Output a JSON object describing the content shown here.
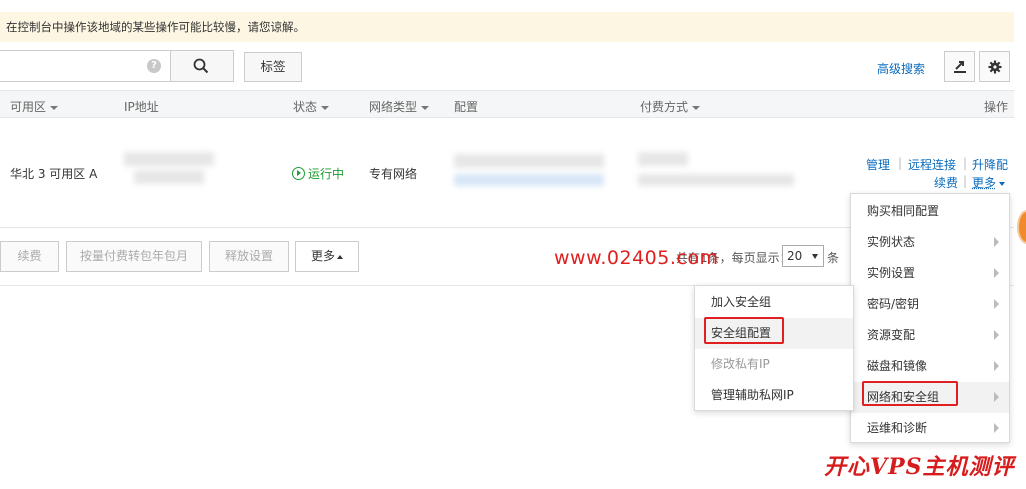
{
  "notice": {
    "text": "在控制台中操作该地域的某些操作可能比较慢，请您谅解。"
  },
  "toolbar": {
    "search_placeholder": "",
    "help_glyph": "?",
    "tag_label": "标签",
    "advanced_search": "高级搜索"
  },
  "table": {
    "headers": {
      "zone": "可用区",
      "ip": "IP地址",
      "status": "状态",
      "network": "网络类型",
      "config": "配置",
      "billing": "付费方式",
      "actions": "操作"
    },
    "row": {
      "zone": "华北 3 可用区 A",
      "status": "运行中",
      "network": "专有网络",
      "actions": {
        "manage": "管理",
        "remote": "远程连接",
        "upgrade": "升降配",
        "renew": "续费",
        "more": "更多"
      }
    }
  },
  "bulk_actions": {
    "renew": "续费",
    "convert": "按量付费转包年包月",
    "release": "释放设置",
    "more": "更多"
  },
  "pager": {
    "total_prefix": "共有1条，每页显示：",
    "page_size": "20",
    "unit": "条"
  },
  "watermark": "www.02405.com",
  "more_menu": {
    "items": [
      {
        "label": "购买相同配置",
        "submenu": false
      },
      {
        "label": "实例状态",
        "submenu": true
      },
      {
        "label": "实例设置",
        "submenu": true
      },
      {
        "label": "密码/密钥",
        "submenu": true
      },
      {
        "label": "资源变配",
        "submenu": true
      },
      {
        "label": "磁盘和镜像",
        "submenu": true
      },
      {
        "label": "网络和安全组",
        "submenu": true
      },
      {
        "label": "运维和诊断",
        "submenu": true
      }
    ]
  },
  "sub_menu": {
    "items": [
      {
        "label": "加入安全组",
        "disabled": false
      },
      {
        "label": "安全组配置",
        "disabled": false
      },
      {
        "label": "修改私有IP",
        "disabled": true
      },
      {
        "label": "管理辅助私网IP",
        "disabled": false
      }
    ]
  },
  "brand": "开心VPS主机测评",
  "colors": {
    "link": "#0a6bbd",
    "running": "#1e9b34",
    "highlight": "#e02020",
    "notice_bg": "#fdf6e3"
  }
}
